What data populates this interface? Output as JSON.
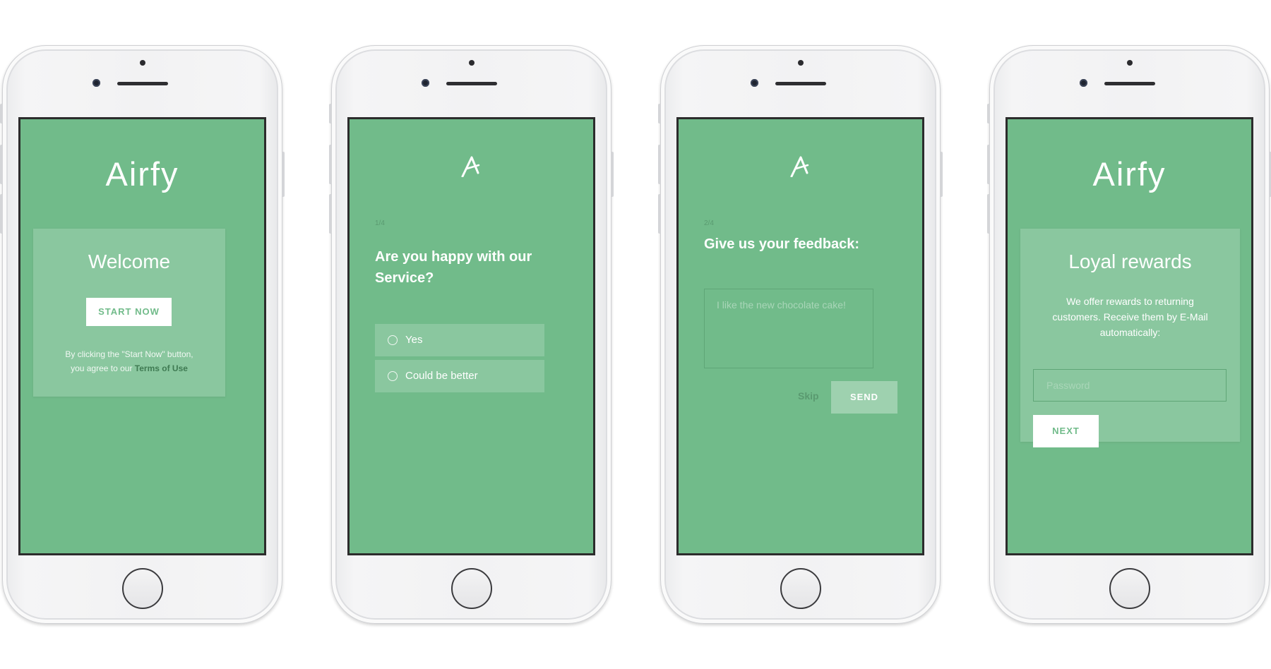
{
  "brand": {
    "name": "Airfy",
    "color": "#71bb8a"
  },
  "screens": {
    "welcome": {
      "title": "Welcome",
      "start_button": "START NOW",
      "legal_line1": "By clicking the \"Start Now\" button,",
      "legal_line2_prefix": "you agree to our ",
      "terms_link": "Terms of Use"
    },
    "question": {
      "step": "1/4",
      "question": "Are you happy with our Service?",
      "options": [
        "Yes",
        "Could be better"
      ]
    },
    "feedback": {
      "step": "2/4",
      "title": "Give us your feedback:",
      "placeholder": "I like the new chocolate cake!",
      "skip_label": "Skip",
      "send_label": "SEND"
    },
    "rewards": {
      "title": "Loyal rewards",
      "description": "We offer rewards to returning customers. Receive them by E-Mail automatically:",
      "password_placeholder": "Password",
      "next_button": "NEXT"
    }
  }
}
